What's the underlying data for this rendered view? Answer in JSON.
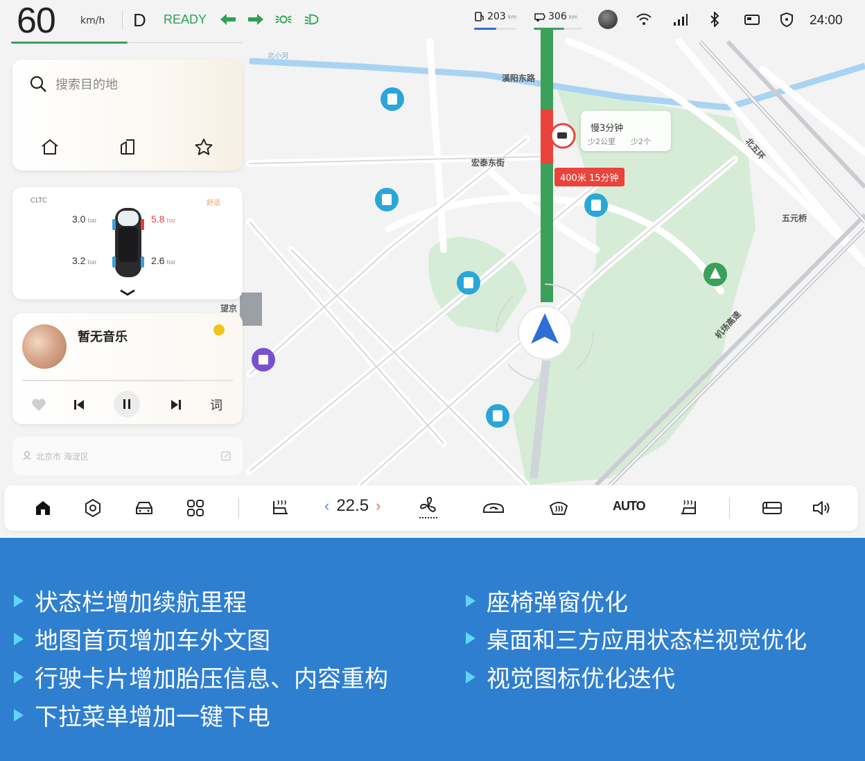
{
  "status_bar": {
    "speed": "60",
    "speed_unit": "km/h",
    "gear": "D",
    "ready": "READY",
    "range_primary": "203",
    "range_primary_unit": "km",
    "range_secondary": "306",
    "range_secondary_unit": "km",
    "time": "24:00",
    "icons": [
      "turn-left-icon",
      "turn-right-icon",
      "position-lights-icon",
      "low-beam-icon",
      "fuel-icon",
      "battery-icon",
      "avatar-icon",
      "wifi-icon",
      "signal-icon",
      "bluetooth-icon",
      "card-icon",
      "shield-icon"
    ]
  },
  "search_card": {
    "placeholder": "搜索目的地",
    "shortcuts": [
      "home-icon",
      "company-icon",
      "favorites-icon"
    ]
  },
  "drive_card": {
    "cltc_label": "CLTC",
    "mode_label": "舒适",
    "tires": {
      "front_left": "3.0",
      "front_right": "5.8",
      "rear_left": "3.2",
      "rear_right": "2.6",
      "unit": "bar"
    }
  },
  "music_card": {
    "title": "暂无音乐",
    "lyric_label": "词"
  },
  "location_card": {
    "text": "北京市 海淀区"
  },
  "map": {
    "roads": {
      "north_road": "溪阳东路",
      "east_street": "宏泰东街",
      "ring": "北五环",
      "bridge": "五元桥",
      "airport": "机场高速",
      "panel_label": "望京",
      "top_road": "北小河"
    },
    "callout": {
      "title": "慢3分钟",
      "detail1": "少2公里",
      "detail2": "少2个"
    },
    "route_tag": "400米 15分钟"
  },
  "dock": {
    "temperature": "22.5",
    "auto_label": "AUTO"
  },
  "release_notes": {
    "left": [
      "状态栏增加续航里程",
      "地图首页增加车外文图",
      "行驶卡片增加胎压信息、内容重构",
      "下拉菜单增加一键下电"
    ],
    "right": [
      "座椅弹窗优化",
      "桌面和三方应用状态栏视觉优化",
      "视觉图标优化迭代"
    ]
  },
  "colors": {
    "accent_green": "#2fa152",
    "route_green": "#3aa05a",
    "traffic_red": "#e9433b",
    "banner_blue": "#2f7fd0",
    "bullet_cyan": "#5fd6ff",
    "poi_blue": "#2aa6d8"
  }
}
